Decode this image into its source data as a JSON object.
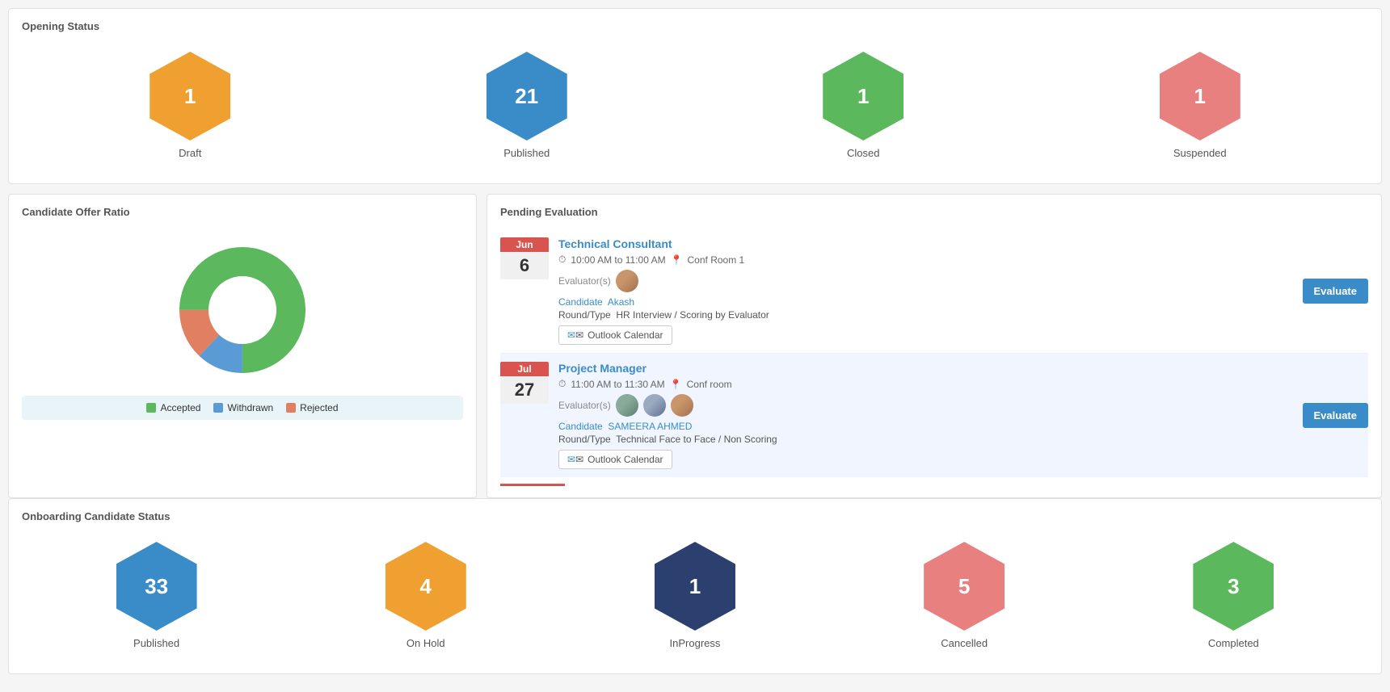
{
  "opening_status": {
    "title": "Opening Status",
    "items": [
      {
        "value": "1",
        "label": "Draft",
        "color": "hex-orange"
      },
      {
        "value": "21",
        "label": "Published",
        "color": "hex-blue"
      },
      {
        "value": "1",
        "label": "Closed",
        "color": "hex-green"
      },
      {
        "value": "1",
        "label": "Suspended",
        "color": "hex-salmon"
      }
    ]
  },
  "candidate_offer": {
    "title": "Candidate Offer Ratio",
    "legend": [
      {
        "label": "Accepted",
        "color": "#5cb85c"
      },
      {
        "label": "Withdrawn",
        "color": "#5b9bd5"
      },
      {
        "label": "Rejected",
        "color": "#e08060"
      }
    ],
    "donut": {
      "segments": [
        {
          "label": "Accepted",
          "value": 75,
          "color": "#5cb85c"
        },
        {
          "label": "Withdrawn",
          "value": 12,
          "color": "#5b9bd5"
        },
        {
          "label": "Rejected",
          "value": 13,
          "color": "#e08060"
        }
      ]
    }
  },
  "pending_evaluation": {
    "title": "Pending Evaluation",
    "items": [
      {
        "month": "Jun",
        "day": "6",
        "job_title": "Technical Consultant",
        "time": "10:00 AM to 11:00 AM",
        "location": "Conf Room 1",
        "evaluators_label": "Evaluator(s)",
        "candidate_label": "Candidate",
        "candidate_name": "Akash",
        "round_label": "Round/Type",
        "round_value": "HR Interview / Scoring by Evaluator",
        "outlook_label": "Outlook Calendar",
        "evaluate_btn": "Evaluate",
        "bg": "white"
      },
      {
        "month": "Jul",
        "day": "27",
        "job_title": "Project Manager",
        "time": "11:00 AM to 11:30 AM",
        "location": "Conf room",
        "evaluators_label": "Evaluator(s)",
        "candidate_label": "Candidate",
        "candidate_name": "SAMEERA AHMED",
        "round_label": "Round/Type",
        "round_value": "Technical Face to Face / Non Scoring",
        "outlook_label": "Outlook Calendar",
        "evaluate_btn": "Evaluate",
        "bg": "light"
      }
    ]
  },
  "onboarding_status": {
    "title": "Onboarding Candidate Status",
    "items": [
      {
        "value": "33",
        "label": "Published",
        "color": "hex-blue"
      },
      {
        "value": "4",
        "label": "On Hold",
        "color": "hex-orange"
      },
      {
        "value": "1",
        "label": "InProgress",
        "color": "hex-darkblue"
      },
      {
        "value": "5",
        "label": "Cancelled",
        "color": "hex-salmon"
      },
      {
        "value": "3",
        "label": "Completed",
        "color": "hex-green"
      }
    ]
  }
}
